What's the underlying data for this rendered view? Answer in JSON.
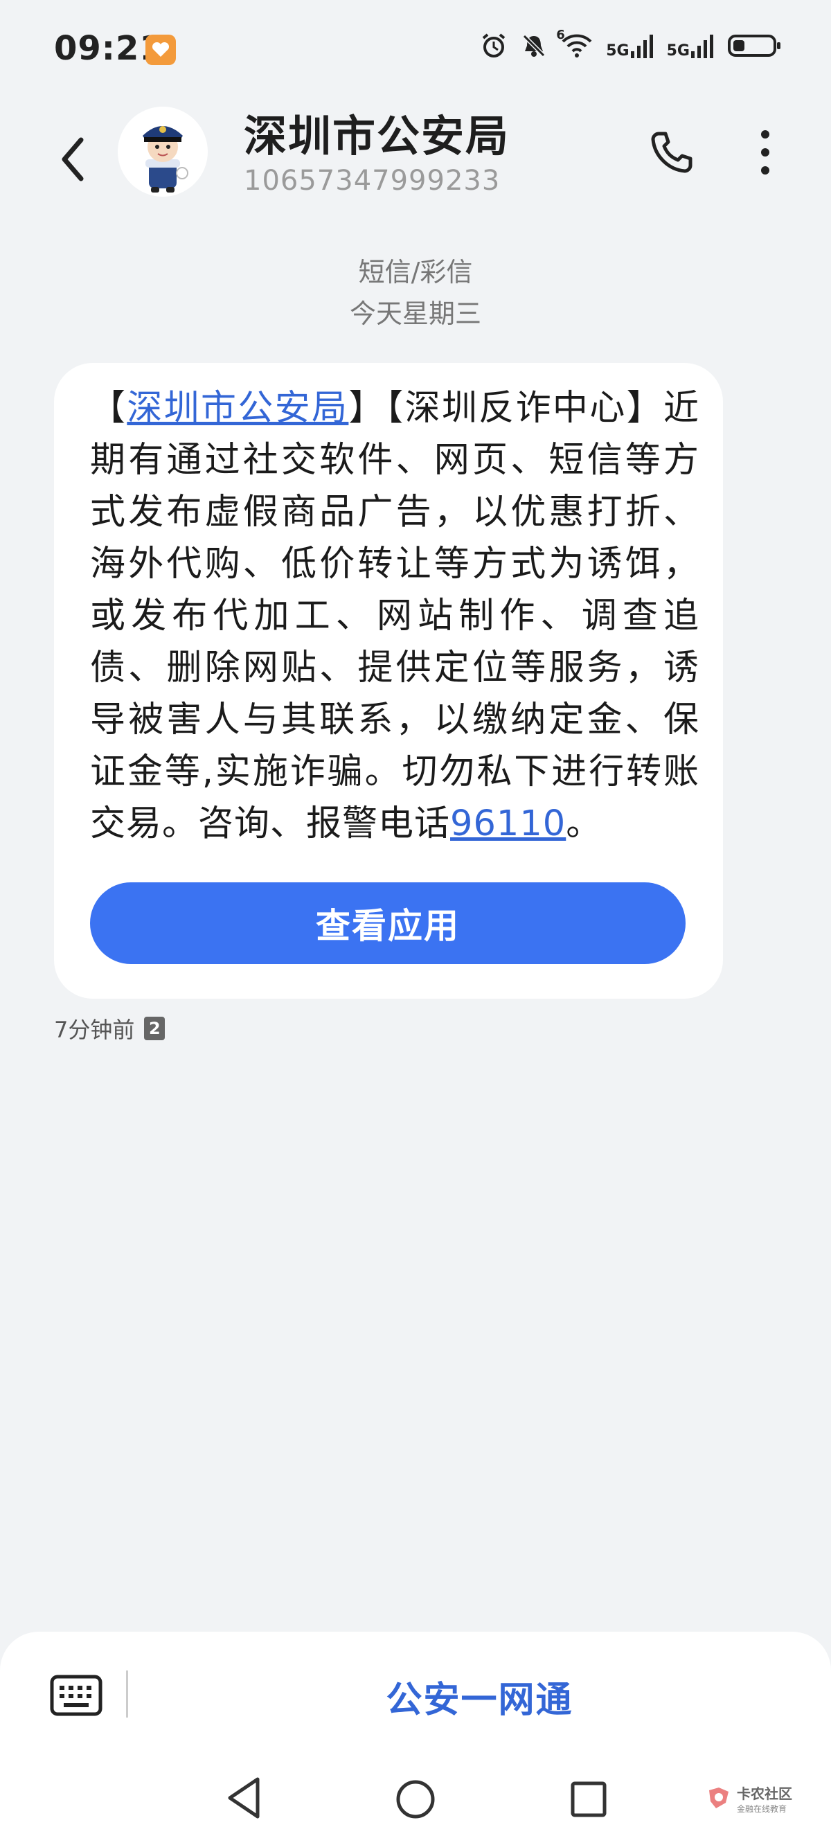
{
  "status_bar": {
    "time": "09:21",
    "net1": "5G",
    "net2": "5G",
    "wifi_label": "6",
    "icons": [
      "alarm-icon",
      "mute-icon",
      "wifi-icon",
      "signal-icon",
      "signal-icon",
      "battery-icon"
    ]
  },
  "header": {
    "contact_name": "深圳市公安局",
    "contact_number": "10657347999233"
  },
  "conversation": {
    "message_type": "短信/彩信",
    "date_label": "今天星期三"
  },
  "message": {
    "link_sender": "深圳市公安局",
    "text_part1": "【",
    "text_part2": "】【深圳反诈中心】近期有通过社交软件、网页、短信等方式发布虚假商品广告，以优惠打折、海外代购、低价转让等方式为诱饵，或发布代加工、网站制作、调查追债、删除网贴、提供定位等服务，诱导被害人与其联系，以缴纳定金、保证金等,实施诈骗。切勿私下进行转账交易。咨询、报警电话",
    "phone_link": "96110",
    "text_end": "。",
    "button_label": "查看应用",
    "time_ago": "7分钟前",
    "sim_slot": "2"
  },
  "bottom_bar": {
    "service_label": "公安一网通"
  },
  "watermark": {
    "text": "卡农社区",
    "sub": "金融在线教育"
  },
  "colors": {
    "background": "#F1F3F5",
    "accent": "#3B73F2",
    "link": "#3366D6"
  }
}
